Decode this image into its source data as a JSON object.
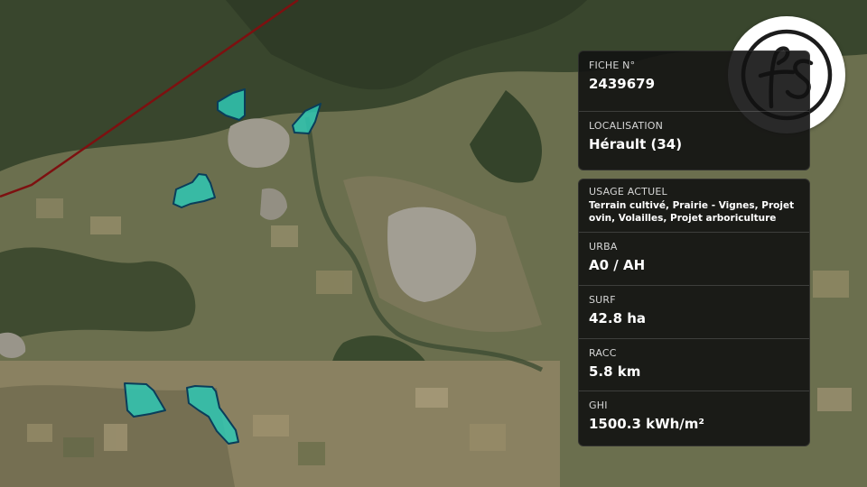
{
  "logo": {
    "text": "fs"
  },
  "colors": {
    "parcel_fill": "#2fc8b4",
    "parcel_stroke": "#0a3d5a",
    "power_line": "#7d1010",
    "panel_bg": "#141414"
  },
  "fiche": {
    "label": "FICHE N°",
    "value": "2439679"
  },
  "localisation": {
    "label": "LOCALISATION",
    "value": "Hérault (34)"
  },
  "usage": {
    "label": "USAGE ACTUEL",
    "line1": "Terrain cultivé, Prairie - Vignes, Projet",
    "line2": "ovin, Volailles, Projet arboriculture"
  },
  "urba": {
    "label": "URBA",
    "value": "A0 / AH"
  },
  "surf": {
    "label": "SURF",
    "value": "42.8 ha"
  },
  "racc": {
    "label": "RACC",
    "value": "5.8 km"
  },
  "ghi": {
    "label": "GHI",
    "value": "1500.3 kWh/m²"
  }
}
